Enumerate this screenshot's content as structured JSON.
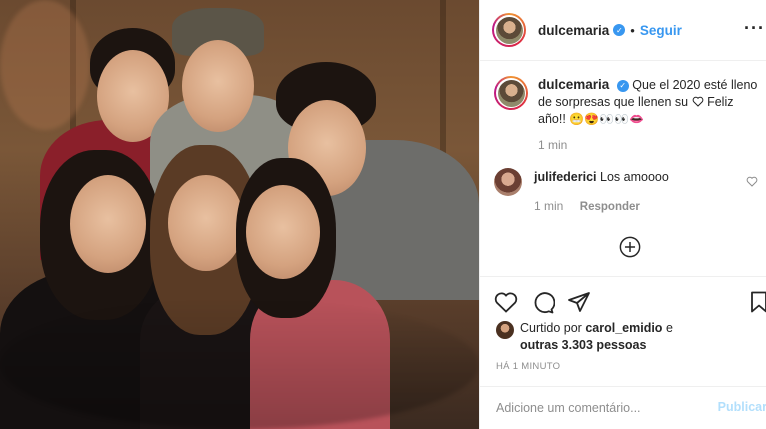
{
  "post": {
    "username": "dulcemaria",
    "follow_label": "Seguir",
    "more_icon": "more-horizontal-icon",
    "caption_main": "Que el 2020 esté lleno de sorpresas que llenen su",
    "caption_tail": "Feliz año!!",
    "caption_emojis": "😬😍👀👀👄",
    "caption_time": "1 min"
  },
  "comments": [
    {
      "username": "julifederici",
      "text": "Los amoooo",
      "time": "1 min",
      "reply_label": "Responder"
    }
  ],
  "actions": {
    "like_icon": "heart-icon",
    "comment_icon": "comment-icon",
    "share_icon": "share-icon",
    "save_icon": "bookmark-icon",
    "load_more_icon": "plus-circle-icon"
  },
  "likes": {
    "prefix": "Curtido por",
    "user": "carol_emidio",
    "suffix": "e",
    "others": "outras 3.303 pessoas"
  },
  "timestamp": "HÁ 1 MINUTO",
  "comment_box": {
    "placeholder": "Adicione um comentário...",
    "publish_label": "Publicar"
  },
  "colors": {
    "link_blue": "#3897f0",
    "publish_disabled": "#b2dffc",
    "muted": "#8e8e8e"
  }
}
